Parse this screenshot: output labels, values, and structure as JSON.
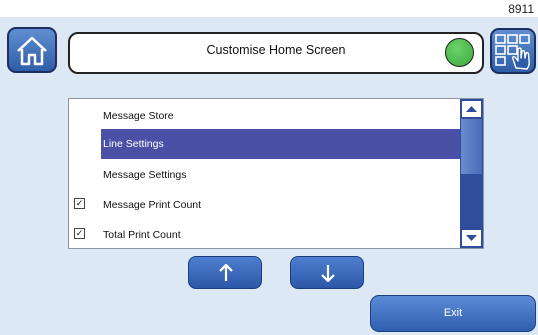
{
  "device": {
    "id": "8911"
  },
  "header": {
    "title": "Customise Home Screen",
    "status_color": "#4caf50"
  },
  "list": {
    "items": [
      {
        "label": "Message Store",
        "checked": false,
        "selected": false
      },
      {
        "label": "Line Settings",
        "checked": false,
        "selected": true
      },
      {
        "label": "Message Settings",
        "checked": false,
        "selected": false
      },
      {
        "label": "Message Print Count",
        "checked": true,
        "selected": false
      },
      {
        "label": "Total Print Count",
        "checked": true,
        "selected": false
      }
    ]
  },
  "buttons": {
    "move_up_icon": "arrow-up",
    "move_down_icon": "arrow-down",
    "exit_label": "Exit"
  },
  "icons": {
    "home": "home-icon",
    "grid": "grid-hand-icon",
    "scroll_up": "triangle-up",
    "scroll_down": "triangle-down"
  }
}
